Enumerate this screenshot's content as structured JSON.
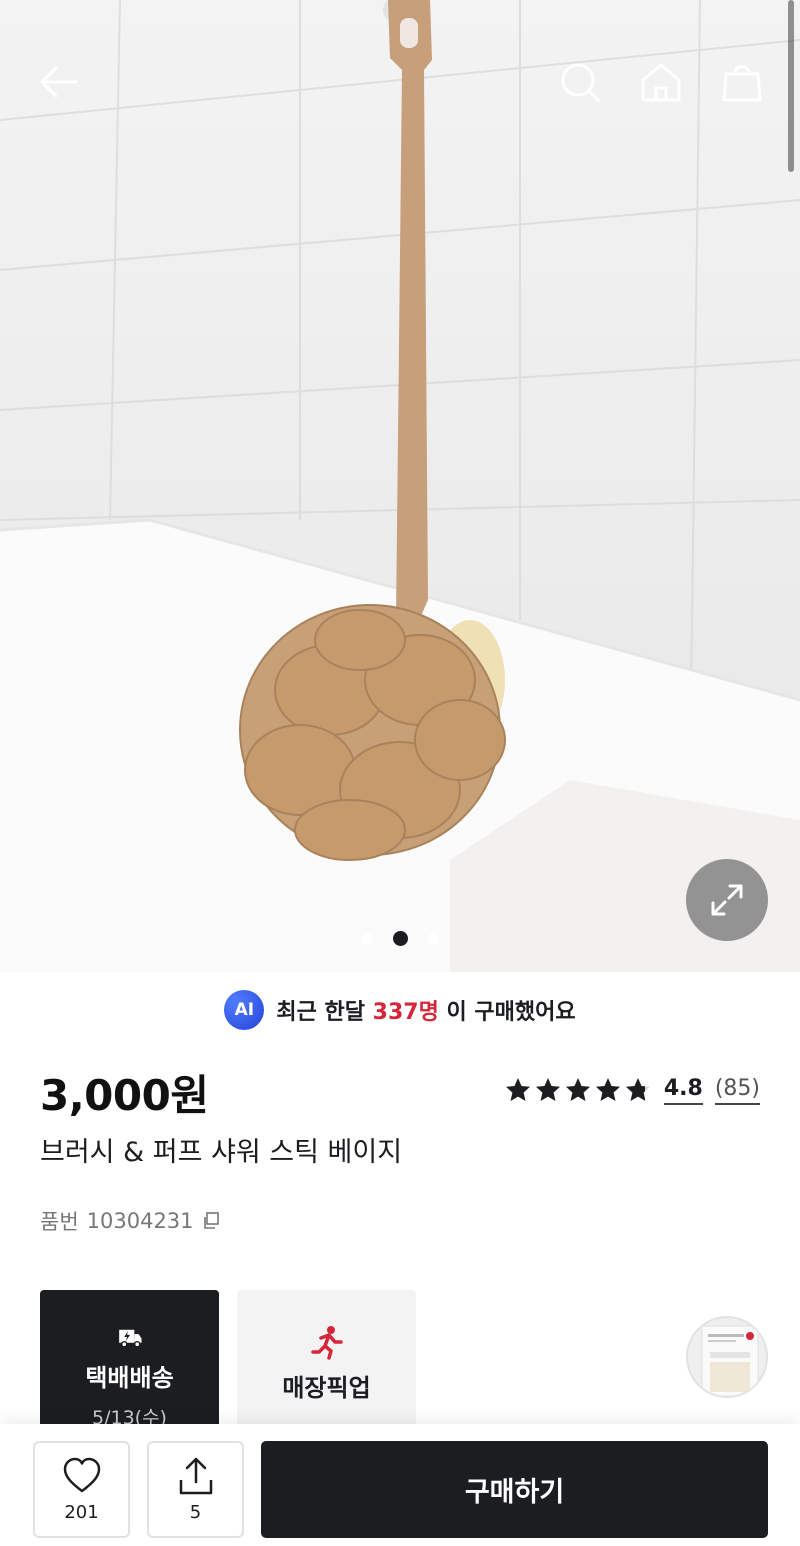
{
  "nav": {
    "back_icon": "back-arrow-icon",
    "search_icon": "search-icon",
    "home_icon": "home-icon",
    "cart_icon": "shopping-bag-icon"
  },
  "gallery": {
    "slide_count": 3,
    "active_slide": 2,
    "expand_icon": "expand-icon"
  },
  "ai_banner": {
    "badge": "AI",
    "prefix": "최근 한달 ",
    "count": "337명",
    "suffix": " 이 구매했어요"
  },
  "product": {
    "price": "3,000원",
    "name": "브러시 & 퍼프 샤워 스틱 베이지",
    "sku_label": "품번",
    "sku_value": "10304231",
    "rating": 4.8,
    "rating_text": "4.8",
    "review_count": "(85)"
  },
  "shipping": {
    "delivery_label": "택배배송",
    "delivery_date": "5/13(수)",
    "pickup_label": "매장픽업"
  },
  "bottom_bar": {
    "like_count": "201",
    "share_count": "5",
    "buy_label": "구매하기"
  },
  "colors": {
    "dark": "#1b1d21",
    "accent_red": "#d6263a",
    "ai_blue": "#2f4ee0",
    "product_beige": "#c9a07a"
  }
}
